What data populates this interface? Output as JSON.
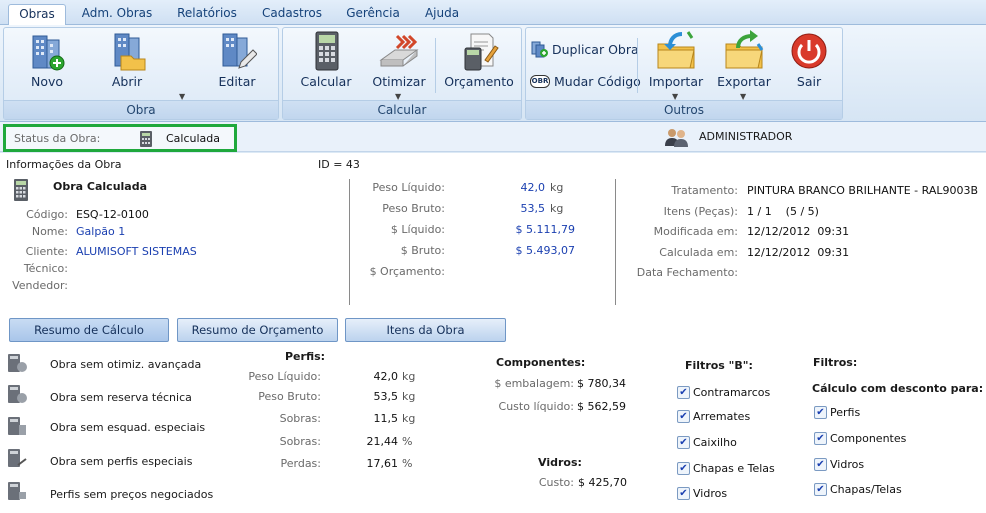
{
  "tabs": [
    "Obras",
    "Adm. Obras",
    "Relatórios",
    "Cadastros",
    "Gerência",
    "Ajuda"
  ],
  "ribbon": {
    "obra_group": {
      "label": "Obra",
      "novo": "Novo",
      "abrir": "Abrir",
      "editar": "Editar"
    },
    "calcular_group": {
      "label": "Calcular",
      "calcular": "Calcular",
      "otimizar": "Otimizar",
      "orcamento": "Orçamento"
    },
    "outros_group": {
      "label": "Outros",
      "duplicar": "Duplicar Obra",
      "mudar_codigo": "Mudar Código",
      "obr_badge": "OBR",
      "importar": "Importar",
      "exportar": "Exportar",
      "sair": "Sair"
    }
  },
  "status": {
    "label": "Status da Obra:",
    "value": "Calculada",
    "user": "ADMINISTRADOR"
  },
  "info": {
    "title": "Informações da Obra",
    "id_text": "ID = 43",
    "subtitle": "Obra Calculada",
    "fields": [
      {
        "label": "Código:",
        "value": "ESQ-12-0100"
      },
      {
        "label": "Nome:",
        "value": "Galpão 1"
      },
      {
        "label": "Cliente:",
        "value": "ALUMISOFT SISTEMAS"
      },
      {
        "label": "Técnico:",
        "value": ""
      },
      {
        "label": "Vendedor:",
        "value": ""
      }
    ],
    "weights": [
      {
        "label": "Peso Líquido:",
        "value": "42,0",
        "unit": "kg"
      },
      {
        "label": "Peso Bruto:",
        "value": "53,5",
        "unit": "kg"
      },
      {
        "label": "$ Líquido:",
        "value": "$ 5.111,79",
        "unit": ""
      },
      {
        "label": "$ Bruto:",
        "value": "$ 5.493,07",
        "unit": ""
      },
      {
        "label": "$ Orçamento:",
        "value": "",
        "unit": ""
      }
    ],
    "details": [
      {
        "label": "Tratamento:",
        "value": "PINTURA BRANCO BRILHANTE - RAL9003B"
      },
      {
        "label": "Itens (Peças):",
        "value": "1 / 1    (5 / 5)"
      },
      {
        "label": "Modificada em:",
        "value": "12/12/2012  09:31"
      },
      {
        "label": "Calculada em:",
        "value": "12/12/2012  09:31"
      },
      {
        "label": "Data Fechamento:",
        "value": ""
      }
    ]
  },
  "buttons": {
    "resumo_calculo": "Resumo de Cálculo",
    "resumo_orcamento": "Resumo de Orçamento",
    "itens_obra": "Itens da Obra"
  },
  "warnings": [
    "Obra sem otimiz. avançada",
    "Obra sem reserva técnica",
    "Obra sem esquad. especiais",
    "Obra sem perfis especiais",
    "Perfis sem preços negociados"
  ],
  "perfis": {
    "title": "Perfis:",
    "rows": [
      {
        "label": "Peso Líquido:",
        "value": "42,0",
        "unit": "kg"
      },
      {
        "label": "Peso Bruto:",
        "value": "53,5",
        "unit": "kg"
      },
      {
        "label": "Sobras:",
        "value": "11,5",
        "unit": "kg"
      },
      {
        "label": "Sobras:",
        "value": "21,44",
        "unit": "%"
      },
      {
        "label": "Perdas:",
        "value": "17,61",
        "unit": "%"
      }
    ]
  },
  "componentes": {
    "title": "Componentes:",
    "embalagem_label": "$ embalagem:",
    "embalagem_value": "$ 780,34",
    "custo_label": "Custo líquido:",
    "custo_value": "$ 562,59"
  },
  "vidros": {
    "title": "Vidros:",
    "custo_label": "Custo:",
    "custo_value": "$ 425,70"
  },
  "filtros_b": {
    "title": "Filtros \"B\":",
    "items": [
      "Contramarcos",
      "Arremates",
      "Caixilho",
      "Chapas e Telas",
      "Vidros"
    ]
  },
  "filtros": {
    "title": "Filtros:",
    "subtitle": "Cálculo com desconto para:",
    "items": [
      "Perfis",
      "Componentes",
      "Vidros",
      "Chapas/Telas"
    ]
  },
  "colors": {
    "accent": "#1fa83c",
    "link": "#1a3fb0"
  }
}
